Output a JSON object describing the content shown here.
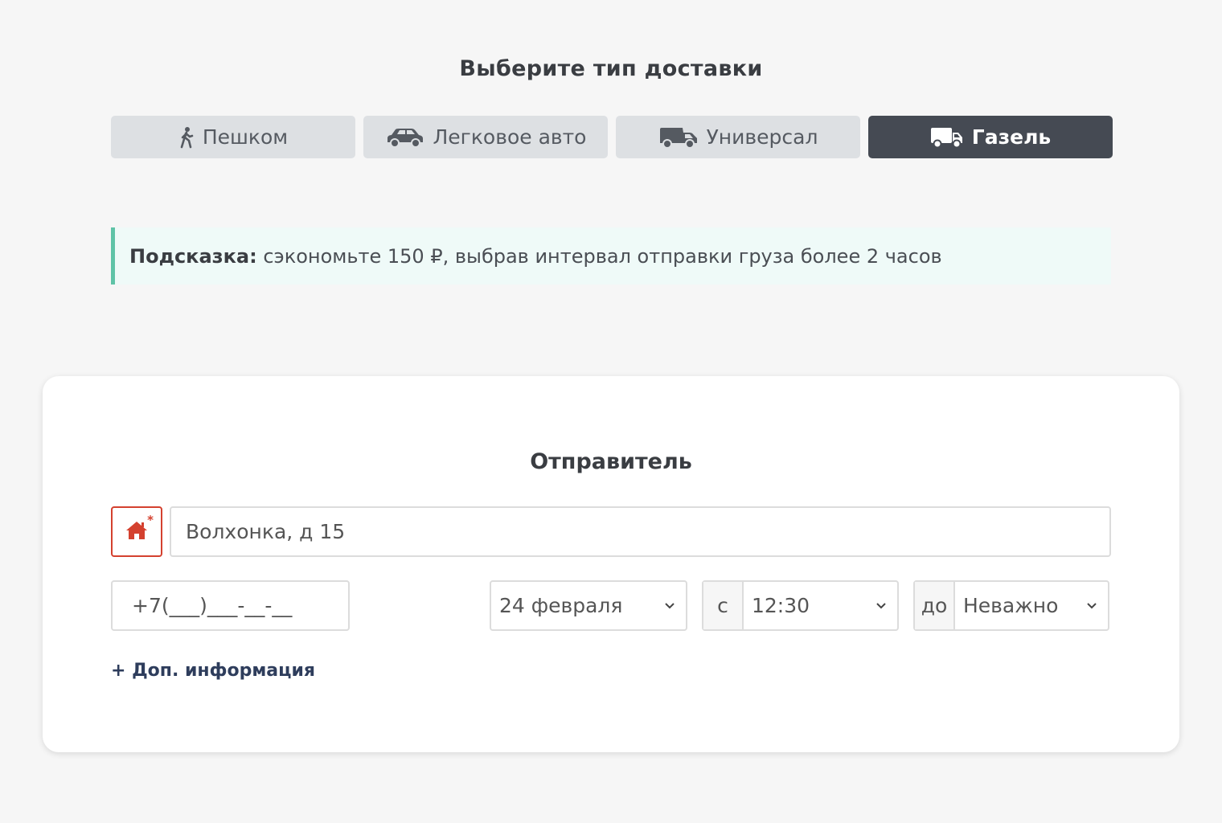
{
  "delivery": {
    "heading": "Выберите тип доставки",
    "tabs": [
      {
        "label": "Пешком",
        "icon": "walking-person-icon",
        "active": false
      },
      {
        "label": "Легковое авто",
        "icon": "car-icon",
        "active": false
      },
      {
        "label": "Универсал",
        "icon": "van-icon",
        "active": false
      },
      {
        "label": "Газель",
        "icon": "truck-icon",
        "active": true
      }
    ]
  },
  "hint": {
    "label": "Подсказка:",
    "text": " сэкономьте 150 ₽, выбрав интервал отправки груза более 2 часов"
  },
  "sender": {
    "title": "Отправитель",
    "address_icon": "home-icon",
    "address_required_mark": "*",
    "address_value": "Волхонка, д 15",
    "phone_placeholder": "+7(___)___-__-__",
    "date": "24 февраля",
    "from_prefix": "с",
    "from_value": "12:30",
    "to_prefix": "до",
    "to_value": "Неважно",
    "more_info": "+ Доп. информация"
  },
  "colors": {
    "active_tab": "#454a53",
    "inactive_tab": "#dde0e3",
    "hint_bg": "#effaf8",
    "hint_border": "#5fc3a7",
    "required_red": "#d4412f",
    "link": "#2e3d5c"
  }
}
